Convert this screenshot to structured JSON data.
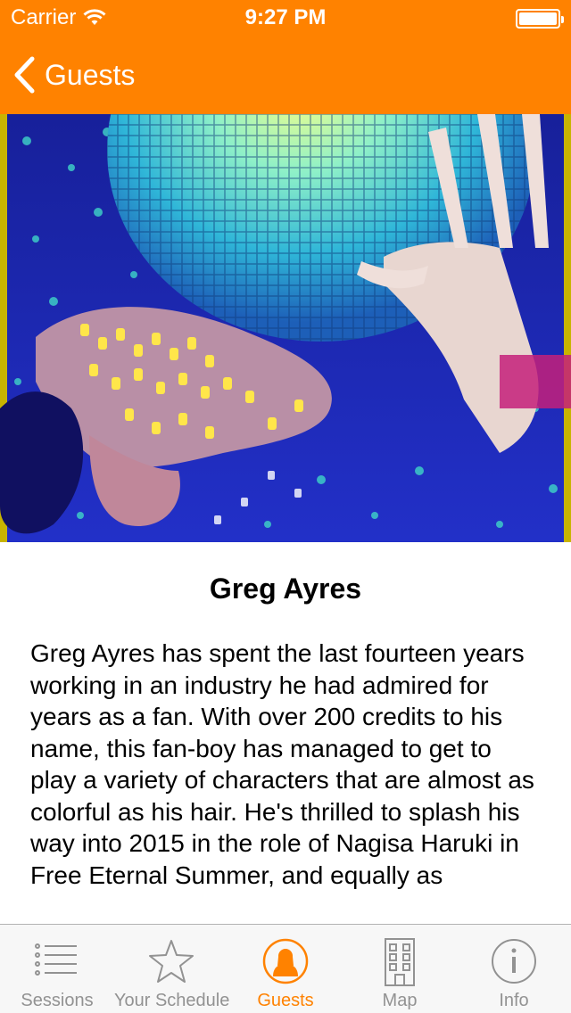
{
  "status_bar": {
    "carrier": "Carrier",
    "time": "9:27 PM"
  },
  "nav": {
    "back_label": "Guests"
  },
  "guest": {
    "name": "Greg Ayres",
    "bio": "Greg Ayres has spent the last fourteen years working in an industry he had admired for years as a fan. With over 200 credits to his name, this fan-boy has managed to get to play a variety of characters that are almost as colorful as his hair. He's thrilled to splash his way into 2015 in the role of Nagisa Haruki in Free Eternal Summer, and equally as"
  },
  "tabs": [
    {
      "label": "Sessions",
      "icon": "list-icon",
      "active": false
    },
    {
      "label": "Your Schedule",
      "icon": "star-icon",
      "active": false
    },
    {
      "label": "Guests",
      "icon": "person-icon",
      "active": true
    },
    {
      "label": "Map",
      "icon": "building-icon",
      "active": false
    },
    {
      "label": "Info",
      "icon": "info-icon",
      "active": false
    }
  ],
  "colors": {
    "accent": "#ff8200",
    "tab_inactive": "#929292"
  }
}
